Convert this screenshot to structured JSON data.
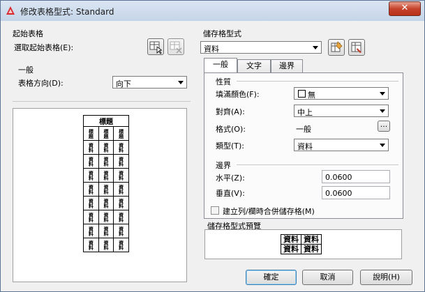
{
  "window": {
    "title": "修改表格型式: Standard",
    "close_glyph": "✕"
  },
  "starting_table": {
    "group_label": "起始表格",
    "select_label": "選取起始表格(E):"
  },
  "general": {
    "group_label": "一般",
    "direction_label": "表格方向(D):",
    "direction_value": "向下"
  },
  "left_preview": {
    "title_text": "標題",
    "header_text": [
      "標題",
      "標題",
      "標題"
    ],
    "data_text": "資料",
    "data_rows": 8
  },
  "cell_styles": {
    "group_label": "儲存格型式",
    "selected": "資料"
  },
  "tabs": [
    {
      "label": "一般",
      "active": true
    },
    {
      "label": "文字",
      "active": false
    },
    {
      "label": "邊界",
      "active": false
    }
  ],
  "properties": {
    "group_label": "性質",
    "fill_color_label": "填滿顏色(F):",
    "fill_color_value": "無",
    "alignment_label": "對齊(A):",
    "alignment_value": "中上",
    "format_label": "格式(O):",
    "format_value": "一般",
    "format_button": "...",
    "type_label": "類型(T):",
    "type_value": "資料"
  },
  "margins": {
    "group_label": "邊界",
    "horizontal_label": "水平(Z):",
    "horizontal_value": "0.0600",
    "vertical_label": "垂直(V):",
    "vertical_value": "0.0600"
  },
  "merge_checkbox": {
    "label": "建立列/欄時合併儲存格(M)",
    "checked": false
  },
  "cell_preview": {
    "group_label": "儲存格型式預覽",
    "cells": [
      [
        "資料",
        "資料"
      ],
      [
        "資料",
        "資料"
      ]
    ]
  },
  "buttons": {
    "ok": "確定",
    "cancel": "取消",
    "help": "說明(H)"
  },
  "colors": {
    "titlebar": "#c4d4e8",
    "close": "#c7432b",
    "accent": "#3c7fb1"
  }
}
